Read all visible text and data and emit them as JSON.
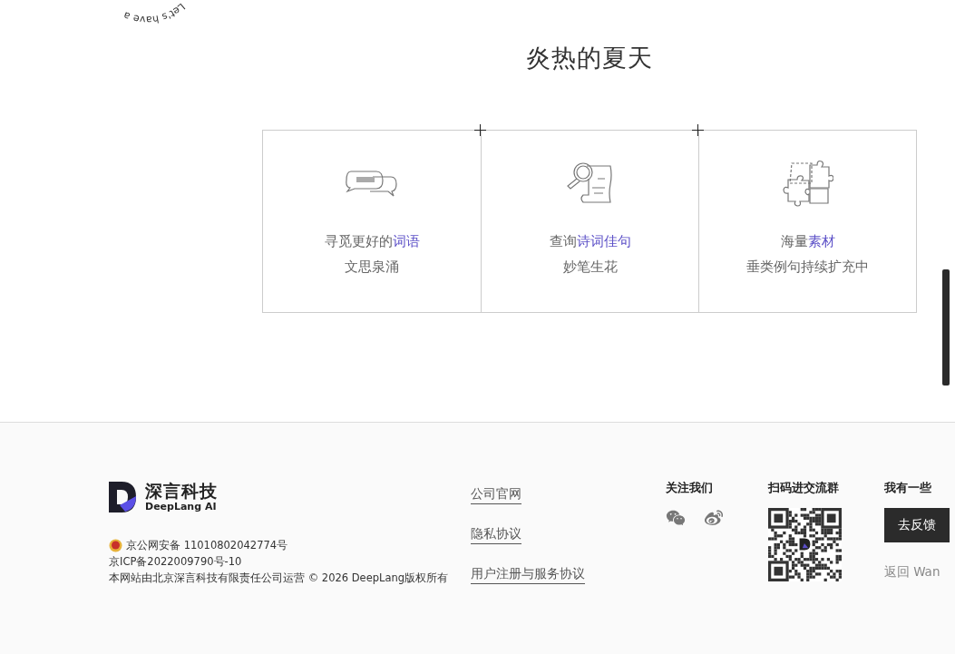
{
  "curved_text": "Let's have a",
  "heading": "炎热的夏天",
  "features": [
    {
      "kind": "word",
      "lead": "寻觅更好的",
      "highlight": "词语",
      "subtitle": "文思泉涌"
    },
    {
      "kind": "poem",
      "lead": "查询",
      "highlight": "诗词佳句",
      "subtitle": "妙笔生花"
    },
    {
      "kind": "puzzle",
      "lead": "海量",
      "highlight": "素材",
      "subtitle": "垂类例句持续扩充中"
    }
  ],
  "footer": {
    "logo": {
      "name": "深言科技",
      "tagline": "DeepLang AI"
    },
    "police_record": "京公网安备 11010802042774号",
    "icp": "京ICP备2022009790号-10",
    "copyright": "本网站由北京深言科技有限责任公司运营 © 2026 DeepLang版权所有",
    "links": [
      "公司官网",
      "隐私协议",
      "用户注册与服务协议"
    ],
    "follow": {
      "title": "关注我们",
      "icons": [
        {
          "kind": "wechat"
        },
        {
          "kind": "weibo"
        }
      ]
    },
    "qr": {
      "title": "扫码进交流群"
    },
    "feedback": {
      "title": "我有一些",
      "button": "去反馈",
      "back": "返回 Wan"
    }
  }
}
